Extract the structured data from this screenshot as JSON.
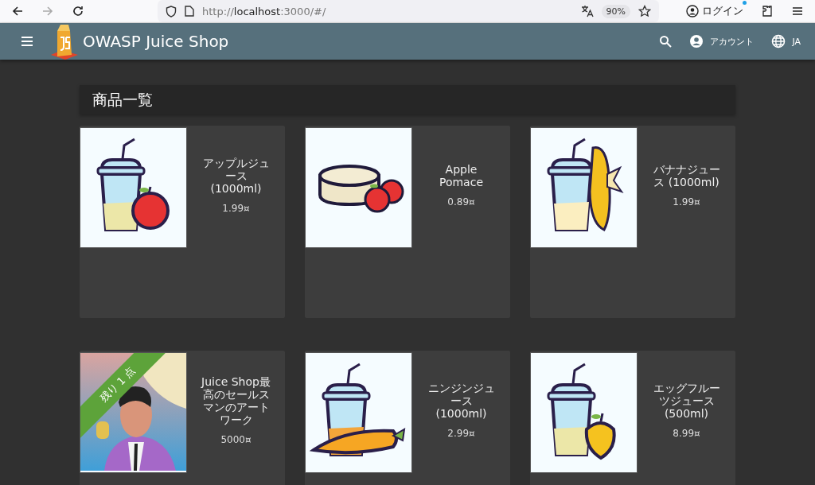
{
  "browser": {
    "url_prefix": "http://",
    "url_host": "localhost",
    "url_rest": ":3000/#/",
    "zoom": "90%",
    "login": "ログイン"
  },
  "toolbar": {
    "title": "OWASP Juice Shop",
    "account": "アカウント",
    "language": "JA"
  },
  "heading": "商品一覧",
  "products": [
    {
      "kind": "cup-apple",
      "name": "アップルジュース (1000ml)",
      "price": "1.99¤"
    },
    {
      "kind": "pomace",
      "name": "Apple Pomace",
      "price": "0.89¤"
    },
    {
      "kind": "cup-banana",
      "name": "バナナジュース (1000ml)",
      "price": "1.99¤"
    },
    {
      "kind": "picture",
      "name": "Juice Shop最高のセールスマンのアートワーク",
      "price": "5000¤",
      "ribbon": "残り 1 点"
    },
    {
      "kind": "cup-carrot",
      "name": "ニンジンジュース (1000ml)",
      "price": "2.99¤"
    },
    {
      "kind": "cup-eggfruit",
      "name": "エッグフルーツジュース (500ml)",
      "price": "8.99¤"
    }
  ]
}
